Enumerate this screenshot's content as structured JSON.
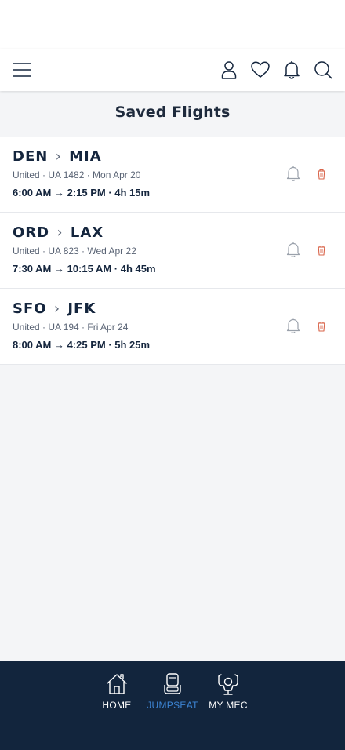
{
  "page_title": "Saved Flights",
  "header": {
    "icons": [
      "menu-icon",
      "profile-icon",
      "heart-icon",
      "bell-icon",
      "search-icon"
    ]
  },
  "flights": [
    {
      "origin": "DEN",
      "destination": "MIA",
      "meta": "United · UA 1482 · Mon Apr 20",
      "times": "6:00 AM → 2:15 PM · 4h 15m"
    },
    {
      "origin": "ORD",
      "destination": "LAX",
      "meta": "United · UA 823 · Wed Apr 22",
      "times": "7:30 AM → 10:15 AM · 4h 45m"
    },
    {
      "origin": "SFO",
      "destination": "JFK",
      "meta": "United · UA 194 · Fri Apr 24",
      "times": "8:00 AM → 4:25 PM · 5h 25m"
    }
  ],
  "route_separator": "›",
  "bottom_nav": {
    "items": [
      {
        "label": "HOME",
        "icon": "home-icon"
      },
      {
        "label": "JUMPSEAT",
        "icon": "seat-icon",
        "active": true
      },
      {
        "label": "MY MEC",
        "icon": "pilot-icon"
      }
    ]
  },
  "colors": {
    "navy": "#12253d",
    "active_blue": "#3d86d6",
    "trash_red": "#d9644a",
    "background": "#f4f5f7"
  }
}
